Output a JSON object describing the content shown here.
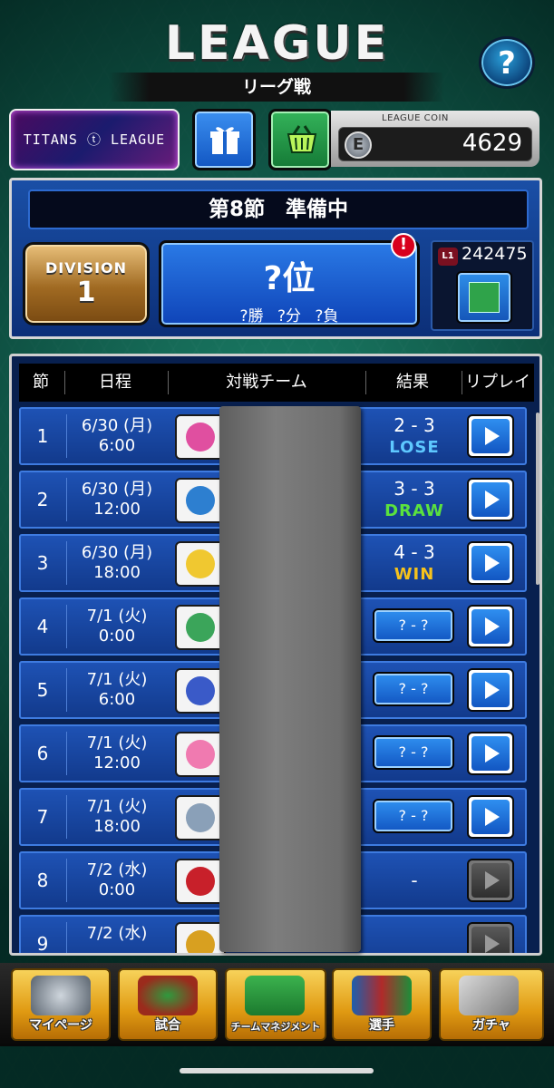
{
  "header": {
    "title": "LEAGUE",
    "subtitle": "リーグ戦",
    "help_label": "?"
  },
  "top_row": {
    "league_banner": "TITANS ⓣ LEAGUE",
    "coin_label": "LEAGUE COIN",
    "coin_icon": "E",
    "coin_value": "4629"
  },
  "status": {
    "round": "第8節　準備中",
    "division_label": "DIVISION",
    "division_value": "1",
    "rank": "?位",
    "record": "?勝 ?分 ?負",
    "alert": "!",
    "level_badge": "L1",
    "points": "242475"
  },
  "table": {
    "headers": [
      "節",
      "日程",
      "対戦チーム",
      "結果",
      "リプレイ"
    ],
    "rows": [
      {
        "num": "1",
        "date": "6/30 (月)",
        "time": "6:00",
        "score": "2 - 3",
        "result": "LOSE",
        "pending": "",
        "dash": ""
      },
      {
        "num": "2",
        "date": "6/30 (月)",
        "time": "12:00",
        "score": "3 - 3",
        "result": "DRAW",
        "pending": "",
        "dash": ""
      },
      {
        "num": "3",
        "date": "6/30 (月)",
        "time": "18:00",
        "score": "4 - 3",
        "result": "WIN",
        "pending": "",
        "dash": ""
      },
      {
        "num": "4",
        "date": "7/1 (火)",
        "time": "0:00",
        "score": "",
        "result": "",
        "pending": "? - ?",
        "dash": ""
      },
      {
        "num": "5",
        "date": "7/1 (火)",
        "time": "6:00",
        "score": "",
        "result": "",
        "pending": "? - ?",
        "dash": ""
      },
      {
        "num": "6",
        "date": "7/1 (火)",
        "time": "12:00",
        "score": "",
        "result": "",
        "pending": "? - ?",
        "dash": ""
      },
      {
        "num": "7",
        "date": "7/1 (火)",
        "time": "18:00",
        "score": "",
        "result": "",
        "pending": "? - ?",
        "dash": ""
      },
      {
        "num": "8",
        "date": "7/2 (水)",
        "time": "0:00",
        "score": "",
        "result": "",
        "pending": "",
        "dash": "-"
      },
      {
        "num": "9",
        "date": "7/2 (水)",
        "time": "",
        "score": "",
        "result": "",
        "pending": "",
        "dash": ""
      }
    ]
  },
  "nav": {
    "items": [
      "マイページ",
      "試合",
      "チームマネジメント",
      "選手",
      "ガチャ"
    ]
  },
  "colors": {
    "lose": "#5ec8ff",
    "draw": "#5be23e",
    "win": "#f6c21c"
  }
}
